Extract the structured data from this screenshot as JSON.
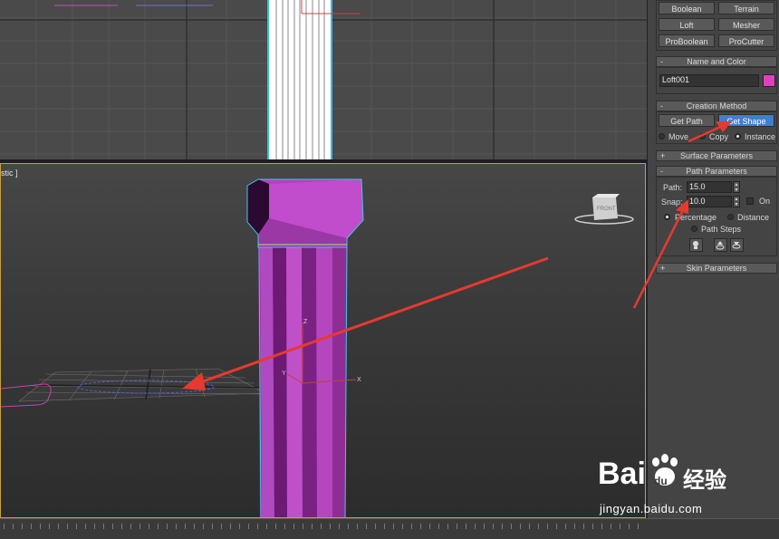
{
  "viewport_persp": {
    "label": "stic ]"
  },
  "panel": {
    "object_type_buttons": [
      "Boolean",
      "Terrain",
      "Loft",
      "Mesher",
      "ProBoolean",
      "ProCutter"
    ],
    "name_and_color": {
      "title": "Name and Color",
      "name_value": "Loft001",
      "swatch_color": "#e040c0"
    },
    "creation_method": {
      "title": "Creation Method",
      "get_path": "Get Path",
      "get_shape": "Get Shape",
      "move": "Move",
      "copy": "Copy",
      "instance": "Instance"
    },
    "surface_parameters": {
      "title": "Surface Parameters"
    },
    "path_parameters": {
      "title": "Path Parameters",
      "path_label": "Path:",
      "path_value": "15.0",
      "snap_label": "Snap:",
      "snap_value": "10.0",
      "on_label": "On",
      "percentage": "Percentage",
      "distance": "Distance",
      "path_steps": "Path Steps"
    },
    "skin_parameters": {
      "title": "Skin Parameters"
    },
    "rollout_minus": "-",
    "rollout_plus": "+"
  },
  "viewcube": {
    "face_label": "FRONT"
  },
  "gizmo": {
    "x_axis": "X",
    "y_axis": "Y",
    "z_axis": "Z"
  },
  "watermark": {
    "brand_a": "Bai",
    "brand_b": "du",
    "brand_cn": "经验",
    "url": "jingyan.baidu.com"
  },
  "colors": {
    "accent_button": "#3f7fcf",
    "object": "#b040c0",
    "arrow": "#e8392f",
    "viewport_border": "#c8a040"
  }
}
